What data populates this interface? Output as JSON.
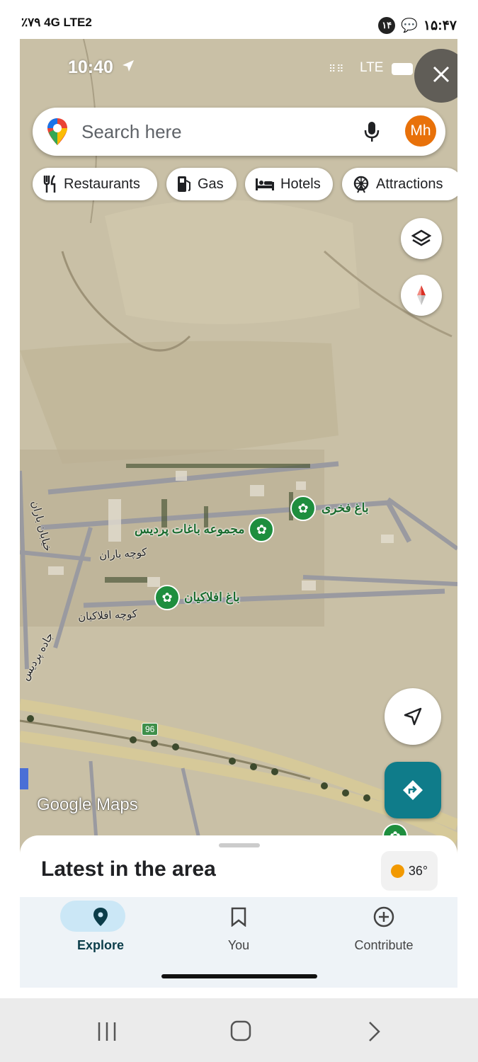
{
  "outer_status": {
    "left_text": "٪۷۹  4G LTE2",
    "notification_count": "۱۴",
    "time": "۱۵:۴۷"
  },
  "inner_status": {
    "time": "10:40",
    "network": "LTE"
  },
  "search": {
    "placeholder": "Search here",
    "avatar_initials": "Mh"
  },
  "chips": [
    {
      "label": "Restaurants",
      "icon": "fork-knife-icon"
    },
    {
      "label": "Gas",
      "icon": "gas-pump-icon"
    },
    {
      "label": "Hotels",
      "icon": "bed-icon"
    },
    {
      "label": "Attractions",
      "icon": "ferris-wheel-icon"
    }
  ],
  "map": {
    "pois": [
      "باغ فخری",
      "مجموعه باغات پردیس",
      "باغ افلاکیان"
    ],
    "streets": [
      "خیابان باران",
      "کوچه باران",
      "کوچه افلاکیان",
      "جاده پردیس"
    ],
    "route_shield": "96",
    "attribution": "Google Maps"
  },
  "sheet": {
    "title": "Latest in the area",
    "temperature": "36°"
  },
  "bottom_nav": [
    {
      "label": "Explore",
      "active": true
    },
    {
      "label": "You",
      "active": false
    },
    {
      "label": "Contribute",
      "active": false
    }
  ]
}
